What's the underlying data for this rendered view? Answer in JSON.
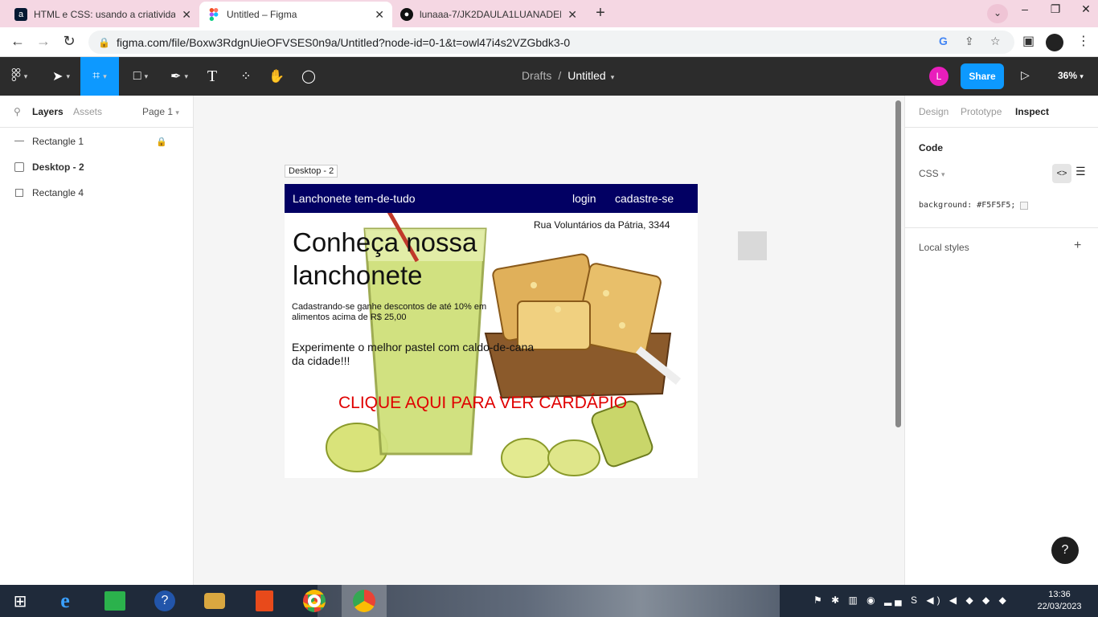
{
  "browser": {
    "tabs": [
      {
        "title": "HTML e CSS: usando a criatividade",
        "icon": "alura-icon"
      },
      {
        "title": "Untitled – Figma",
        "icon": "figma-icon"
      },
      {
        "title": "lunaaa-7/JK2DAULA1LUANADEBRITO",
        "icon": "github-icon"
      }
    ],
    "new_tab": "+",
    "url": "figma.com/file/Boxw3RdgnUieOFVSES0n9a/Untitled?node-id=0-1&t=owl47i4s2VZGbdk3-0"
  },
  "figma_toolbar": {
    "breadcrumb_drafts": "Drafts",
    "breadcrumb_sep": "/",
    "file_name": "Untitled",
    "user_initial": "L",
    "share_label": "Share",
    "zoom": "36%"
  },
  "left_panel": {
    "tab_layers": "Layers",
    "tab_assets": "Assets",
    "page": "Page 1",
    "layers": [
      {
        "name": "Rectangle 1",
        "locked": true
      },
      {
        "name": "Desktop - 2",
        "locked": false
      },
      {
        "name": "Rectangle 4",
        "locked": false
      }
    ],
    "lock_glyph": "🔒"
  },
  "canvas": {
    "frame_label": "Desktop - 2",
    "site": {
      "brand": "Lanchonete tem-de-tudo",
      "login": "login",
      "signup": "cadastre-se",
      "address": "Rua Voluntários da Pátria, 3344",
      "headline": "Conheça nossa lanchonete",
      "promo": "Cadastrando-se ganhe descontos de até 10% em alimentos acima de R$ 25,00",
      "pastel": "Experimente o melhor pastel com caldo-de-cana da cidade!!!",
      "cta": "CLIQUE AQUI PARA VER CARDÁPIO",
      "nav_color": "#020063",
      "cta_color": "#e00000"
    }
  },
  "right_panel": {
    "tab_design": "Design",
    "tab_prototype": "Prototype",
    "tab_inspect": "Inspect",
    "code_heading": "Code",
    "language": "CSS",
    "css_line": "background: #F5F5F5;",
    "local_styles": "Local styles",
    "help": "?"
  },
  "taskbar": {
    "time": "13:36",
    "date": "22/03/2023"
  }
}
